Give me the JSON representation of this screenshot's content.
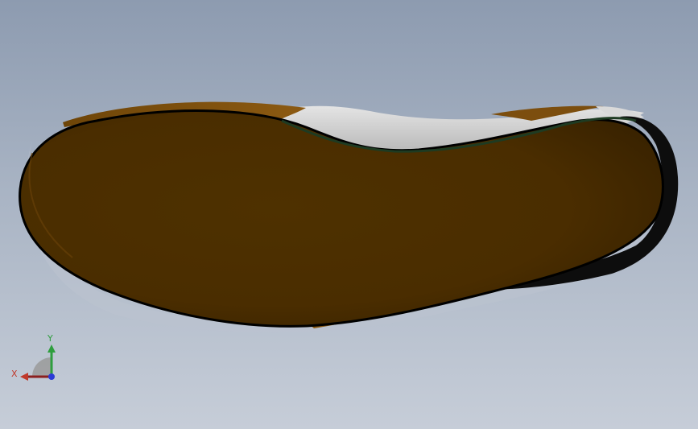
{
  "viewport": {
    "background_top": "#8d9bb0",
    "background_bottom": "#c6cdd8"
  },
  "model": {
    "sole_color": "#4d2f00",
    "sole_edge_color": "#7a4d0c",
    "upper_color": "#cfcfcf",
    "outline_color": "#000000",
    "welt_color": "#1e3b22",
    "heel_cap_color": "#111111"
  },
  "triad": {
    "x_label": "X",
    "y_label": "Y",
    "x_color": "#c0392b",
    "y_color": "#2e9e3e",
    "z_color": "#2b3bd6"
  }
}
